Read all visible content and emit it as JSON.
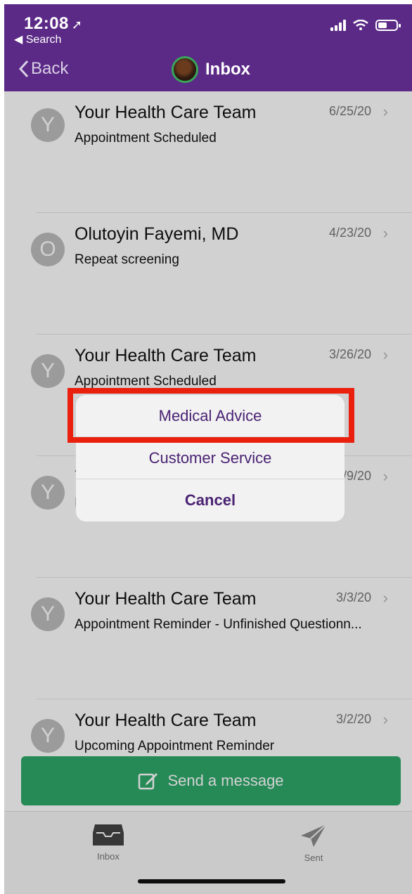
{
  "status_bar": {
    "time": "12:08",
    "location_glyph": "➚",
    "back_app": "◀ Search"
  },
  "nav": {
    "back_label": "Back",
    "title": "Inbox"
  },
  "messages": [
    {
      "avatar_letter": "Y",
      "sender": "Your Health Care Team",
      "subject": "Appointment Scheduled",
      "date": "6/25/20"
    },
    {
      "avatar_letter": "O",
      "sender": "Olutoyin Fayemi, MD",
      "subject": "Repeat screening",
      "date": "4/23/20"
    },
    {
      "avatar_letter": "Y",
      "sender": "Your Health Care Team",
      "subject": "Appointment Scheduled",
      "date": "3/26/20"
    },
    {
      "avatar_letter": "Y",
      "sender": "Y",
      "subject": "I",
      "date": "3/9/20"
    },
    {
      "avatar_letter": "Y",
      "sender": "Your Health Care Team",
      "subject": "Appointment Reminder - Unfinished Questionn...",
      "date": "3/3/20"
    },
    {
      "avatar_letter": "Y",
      "sender": "Your Health Care Team",
      "subject": "Upcoming Appointment Reminder",
      "date": "3/2/20"
    }
  ],
  "send_button": {
    "label": "Send a message",
    "icon": "compose-icon"
  },
  "tabs": [
    {
      "label": "Inbox",
      "icon": "inbox-tray-icon"
    },
    {
      "label": "Sent",
      "icon": "paper-plane-icon"
    }
  ],
  "action_sheet": {
    "options": [
      "Medical Advice",
      "Customer Service"
    ],
    "cancel_label": "Cancel"
  },
  "colors": {
    "header_purple": "#5b2a86",
    "send_green": "#2fa96b",
    "highlight_red": "#ea1f0d",
    "sheet_text": "#4a2273"
  }
}
